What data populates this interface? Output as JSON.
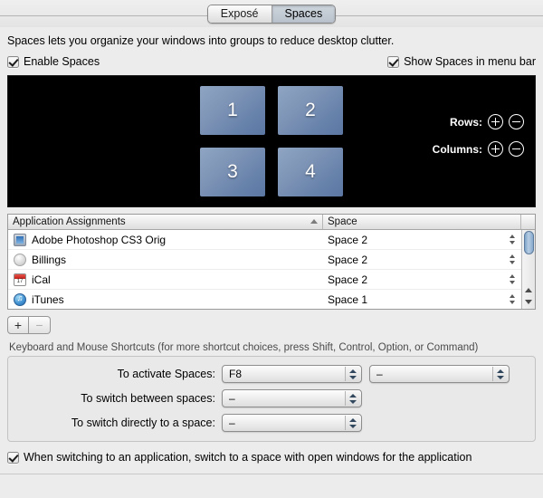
{
  "tabs": [
    {
      "label": "Exposé",
      "selected": false
    },
    {
      "label": "Spaces",
      "selected": true
    }
  ],
  "description": "Spaces lets you organize your windows into groups to reduce desktop clutter.",
  "options": {
    "enable_spaces": {
      "label": "Enable Spaces",
      "checked": true
    },
    "show_in_menu_bar": {
      "label": "Show Spaces in menu bar",
      "checked": true
    },
    "switch_to_space_with_windows": {
      "label": "When switching to an application, switch to a space with open windows for the application",
      "checked": true
    }
  },
  "preview": {
    "tiles": [
      "1",
      "2",
      "3",
      "4"
    ],
    "rows_label": "Rows:",
    "columns_label": "Columns:",
    "background_color": "#000000",
    "tile_color": "#6782ab",
    "plus_icon": "plus-circle-icon",
    "minus_icon": "minus-circle-icon"
  },
  "table": {
    "headers": {
      "application": "Application Assignments",
      "space": "Space"
    },
    "sort_column": "application",
    "sort_direction": "ascending",
    "rows": [
      {
        "app": "Adobe Photoshop CS3 Orig",
        "icon": "photoshop-icon",
        "space": "Space 2"
      },
      {
        "app": "Billings",
        "icon": "billings-icon",
        "space": "Space 2"
      },
      {
        "app": "iCal",
        "icon": "ical-icon",
        "space": "Space 2"
      },
      {
        "app": "iTunes",
        "icon": "itunes-icon",
        "space": "Space 1"
      }
    ]
  },
  "list_buttons": {
    "add": "+",
    "remove": "−"
  },
  "shortcuts": {
    "group_label": "Keyboard and Mouse Shortcuts (for more shortcut choices, press Shift, Control, Option, or Command)",
    "rows": [
      {
        "label": "To activate Spaces:",
        "primary": "F8",
        "secondary": "–",
        "has_secondary": true
      },
      {
        "label": "To switch between spaces:",
        "primary": "–",
        "has_secondary": false
      },
      {
        "label": "To switch directly to a space:",
        "primary": "–",
        "has_secondary": false
      }
    ]
  }
}
